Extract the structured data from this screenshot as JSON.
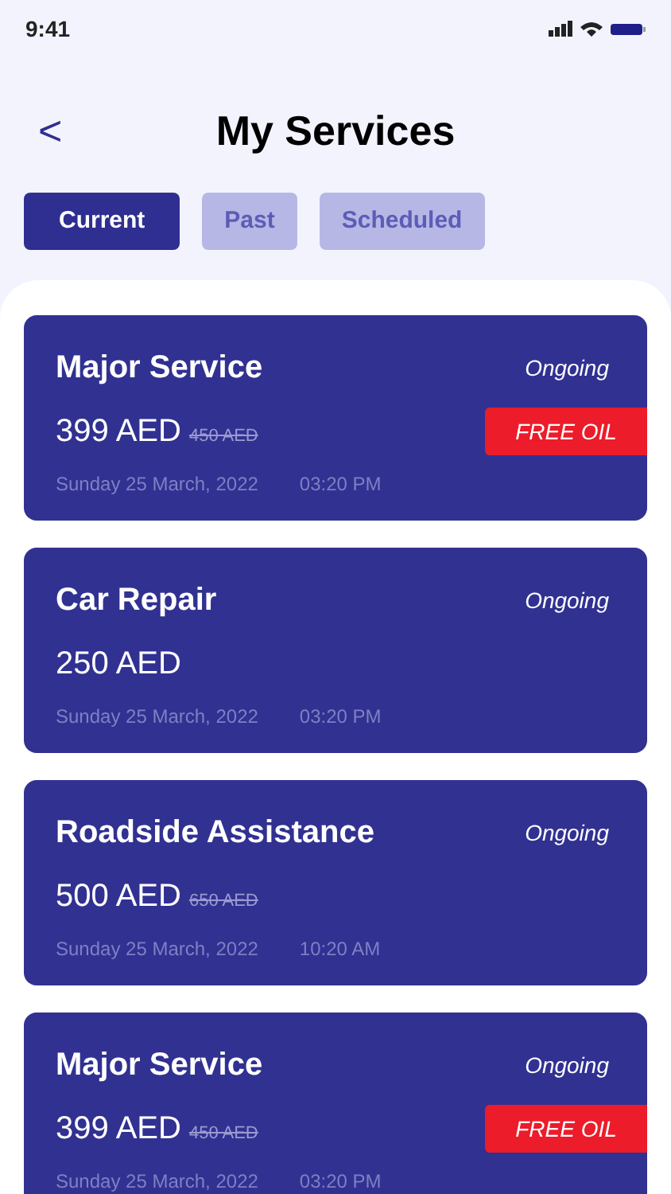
{
  "status_bar": {
    "time": "9:41"
  },
  "header": {
    "back": "<",
    "title": "My Services"
  },
  "tabs": [
    {
      "label": "Current",
      "selected": true
    },
    {
      "label": "Past",
      "selected": false
    },
    {
      "label": "Scheduled",
      "selected": false
    }
  ],
  "services": [
    {
      "name": "Major Service",
      "status": "Ongoing",
      "price": "399 AED",
      "old_price": "450 AED",
      "badge": "FREE OIL",
      "date": "Sunday 25 March, 2022",
      "time": "03:20 PM"
    },
    {
      "name": "Car Repair",
      "status": "Ongoing",
      "price": "250 AED",
      "date": "Sunday 25 March, 2022",
      "time": "03:20 PM"
    },
    {
      "name": "Roadside Assistance",
      "status": "Ongoing",
      "price": "500 AED",
      "old_price": "650 AED",
      "date": "Sunday 25 March, 2022",
      "time": "10:20 AM"
    },
    {
      "name": "Major Service",
      "status": "Ongoing",
      "price": "399 AED",
      "old_price": "450 AED",
      "badge": "FREE OIL",
      "date": "Sunday 25 March, 2022",
      "time": "03:20 PM"
    }
  ]
}
